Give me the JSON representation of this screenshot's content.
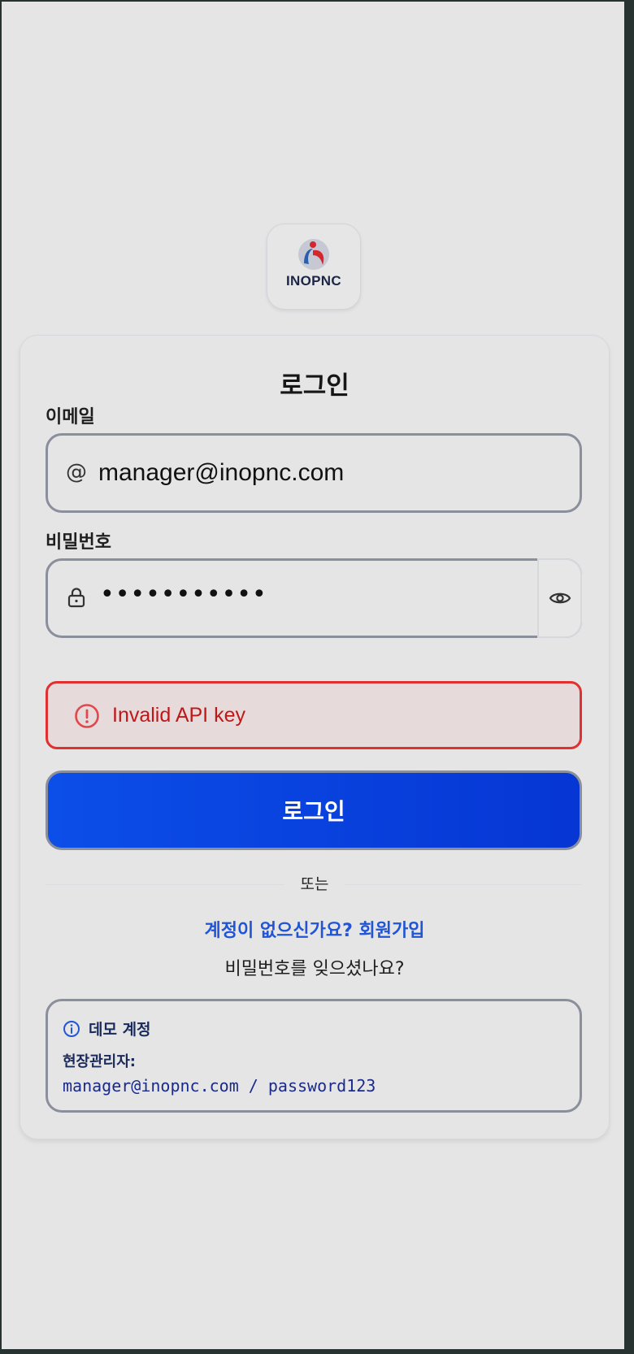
{
  "brand": {
    "name": "INOPNC"
  },
  "login": {
    "title": "로그인",
    "email_label": "이메일",
    "email_value": "manager@inopnc.com",
    "password_label": "비밀번호",
    "password_masked": "•••••••••••",
    "error_message": "Invalid API key",
    "submit_label": "로그인",
    "divider_text": "또는",
    "signup_link": "계정이 없으신가요? 회원가입",
    "forgot_link": "비밀번호를 잊으셨나요?"
  },
  "demo": {
    "title": "데모 계정",
    "role": "현장관리자:",
    "credentials": "manager@inopnc.com / password123"
  },
  "colors": {
    "primary": "#0c4ee8",
    "error": "#e03030",
    "link": "#1f55d6"
  }
}
